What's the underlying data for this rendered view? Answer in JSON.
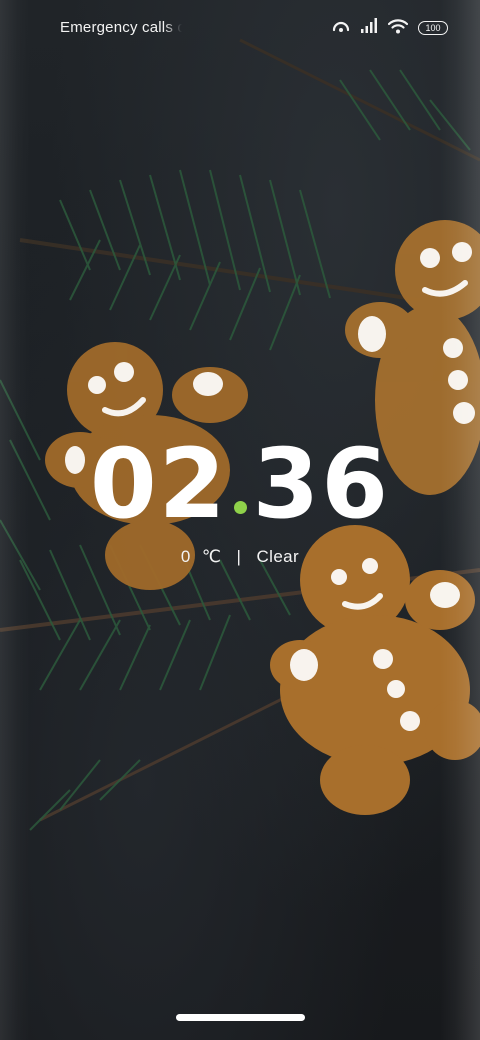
{
  "status_bar": {
    "carrier_text": "Emergency calls o",
    "battery_level": "100",
    "icons": [
      "alarm-icon",
      "signal-icon",
      "wifi-icon",
      "battery-icon"
    ]
  },
  "lockscreen": {
    "time_hours": "02",
    "time_minutes": "36",
    "temperature": "0",
    "temperature_unit": "℃",
    "condition": "Clear",
    "accent_dot_color": "#8fd14a"
  }
}
